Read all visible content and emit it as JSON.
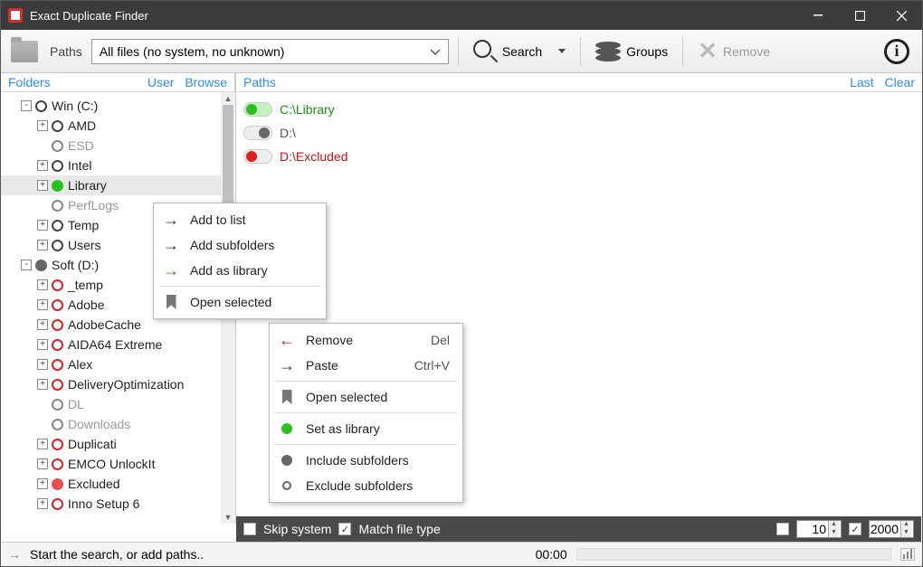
{
  "window": {
    "title": "Exact Duplicate Finder"
  },
  "toolbar": {
    "paths_label": "Paths",
    "filter_value": "All files (no system, no unknown)",
    "search_label": "Search",
    "groups_label": "Groups",
    "remove_label": "Remove"
  },
  "left_header": {
    "title": "Folders",
    "link_user": "User",
    "link_browse": "Browse"
  },
  "right_header": {
    "title": "Paths",
    "link_last": "Last",
    "link_clear": "Clear"
  },
  "tree": [
    {
      "lvl": 0,
      "exp": "-",
      "icon": "ring",
      "label": "Win (C:)"
    },
    {
      "lvl": 1,
      "exp": "+",
      "icon": "ring",
      "label": "AMD"
    },
    {
      "lvl": 1,
      "exp": " ",
      "icon": "ring-gray",
      "label": "ESD",
      "muted": true
    },
    {
      "lvl": 1,
      "exp": "+",
      "icon": "ring",
      "label": "Intel"
    },
    {
      "lvl": 1,
      "exp": "+",
      "icon": "dot-green",
      "label": "Library",
      "sel": true
    },
    {
      "lvl": 1,
      "exp": " ",
      "icon": "ring-gray",
      "label": "PerfLogs",
      "muted": true
    },
    {
      "lvl": 1,
      "exp": "+",
      "icon": "ring",
      "label": "Temp"
    },
    {
      "lvl": 1,
      "exp": "+",
      "icon": "ring",
      "label": "Users"
    },
    {
      "lvl": 0,
      "exp": "-",
      "icon": "dot-gray",
      "label": "Soft (D:)"
    },
    {
      "lvl": 1,
      "exp": "+",
      "icon": "ring-red",
      "label": "_temp"
    },
    {
      "lvl": 1,
      "exp": "+",
      "icon": "ring-red",
      "label": "Adobe"
    },
    {
      "lvl": 1,
      "exp": "+",
      "icon": "ring-red",
      "label": "AdobeCache"
    },
    {
      "lvl": 1,
      "exp": "+",
      "icon": "ring-red",
      "label": "AIDA64 Extreme"
    },
    {
      "lvl": 1,
      "exp": "+",
      "icon": "ring-red",
      "label": "Alex"
    },
    {
      "lvl": 1,
      "exp": "+",
      "icon": "ring-red",
      "label": "DeliveryOptimization"
    },
    {
      "lvl": 1,
      "exp": " ",
      "icon": "ring-gray",
      "label": "DL",
      "muted": true
    },
    {
      "lvl": 1,
      "exp": " ",
      "icon": "ring-gray",
      "label": "Downloads",
      "muted": true
    },
    {
      "lvl": 1,
      "exp": "+",
      "icon": "ring-red",
      "label": "Duplicati"
    },
    {
      "lvl": 1,
      "exp": "+",
      "icon": "ring-red",
      "label": "EMCO UnlockIt"
    },
    {
      "lvl": 1,
      "exp": "+",
      "icon": "dot-red",
      "label": "Excluded"
    },
    {
      "lvl": 1,
      "exp": "+",
      "icon": "ring-red",
      "label": "Inno Setup 6"
    }
  ],
  "paths": [
    {
      "state": "on-green",
      "text": "C:\\Library",
      "cls": "green"
    },
    {
      "state": "off-gray",
      "text": "D:\\",
      "cls": "gray"
    },
    {
      "state": "on-red",
      "text": "D:\\Excluded",
      "cls": "red"
    }
  ],
  "menu_left": {
    "add_to_list": "Add to list",
    "add_subfolders": "Add subfolders",
    "add_as_library": "Add as library",
    "open_selected": "Open selected"
  },
  "menu_right": {
    "remove": "Remove",
    "remove_key": "Del",
    "paste": "Paste",
    "paste_key": "Ctrl+V",
    "open_selected": "Open selected",
    "set_as_library": "Set as library",
    "include_subfolders": "Include subfolders",
    "exclude_subfolders": "Exclude subfolders"
  },
  "bottom": {
    "skip_system": "Skip system",
    "match_file_type": "Match file type",
    "num1": "10",
    "num2": "2000"
  },
  "status": {
    "hint": "Start the search, or add paths..",
    "time": "00:00"
  }
}
